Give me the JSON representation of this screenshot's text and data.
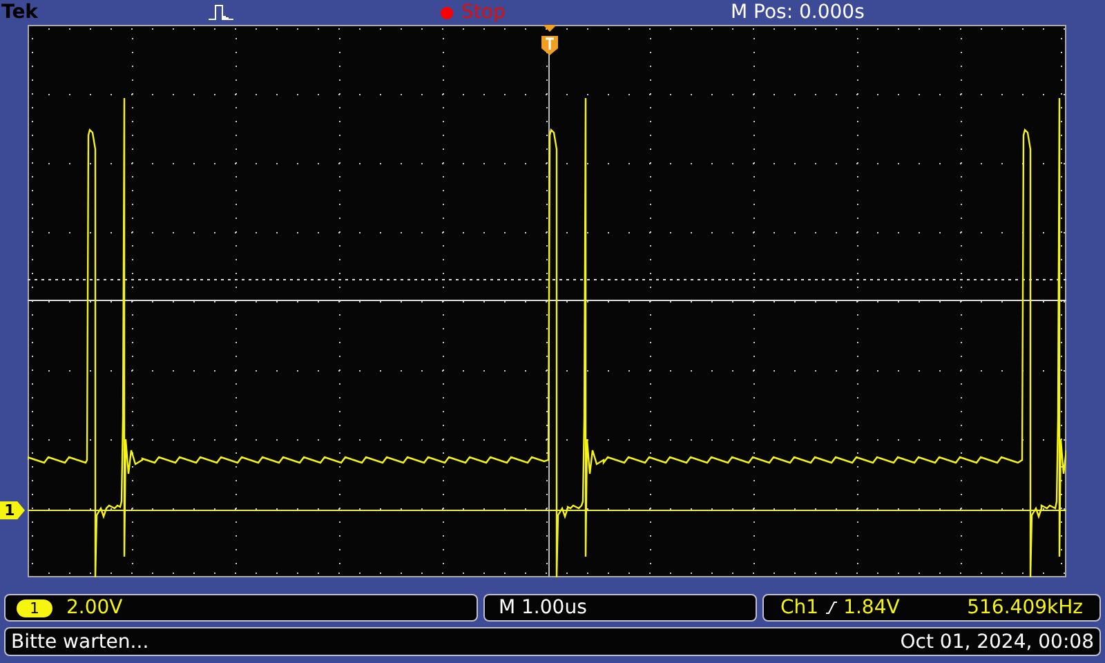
{
  "header": {
    "brand": "Tek",
    "acquisition": {
      "running": false,
      "label": "Stop"
    },
    "position": "M Pos: 0.000s"
  },
  "channel_marker": "1",
  "readouts": {
    "channel": {
      "badge": "1",
      "scale": "2.00V"
    },
    "timebase": "M 1.00us",
    "trigger": {
      "source": "Ch1",
      "level": "1.84V",
      "frequency": "516.409kHz"
    }
  },
  "status_bar": {
    "message": "Bitte warten...",
    "datetime": "Oct 01, 2024, 00:08"
  }
}
